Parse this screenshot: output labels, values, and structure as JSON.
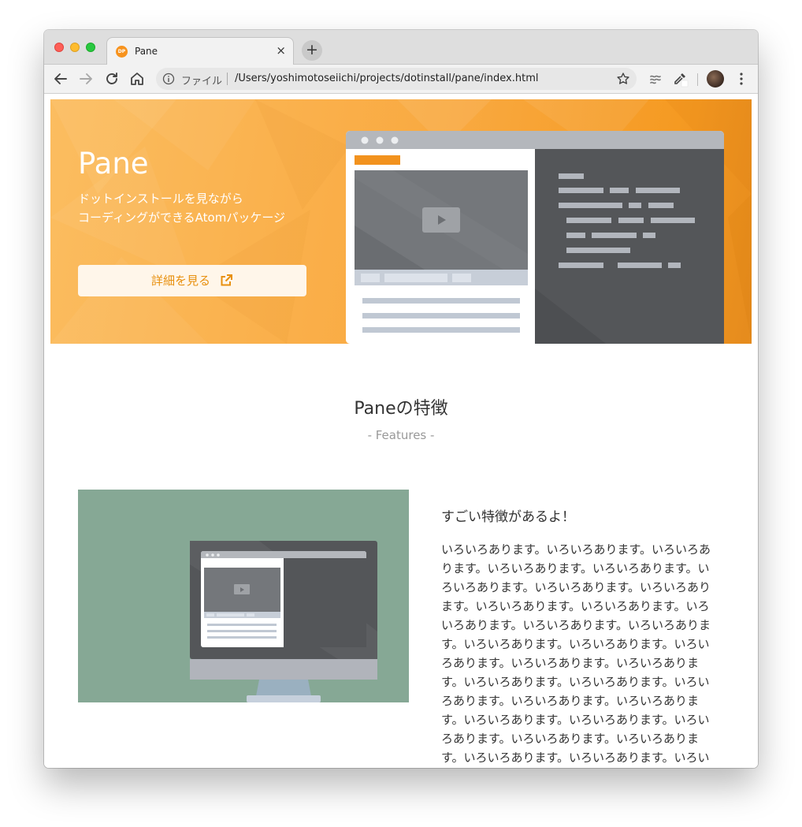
{
  "browser": {
    "tab": {
      "title": "Pane",
      "favicon_text": "DP",
      "close_glyph": "×"
    },
    "new_tab_glyph": "+",
    "address_bar": {
      "scheme_label": "ファイル",
      "url": "/Users/yoshimotoseiichi/projects/dotinstall/pane/index.html"
    },
    "icons": [
      "back-icon",
      "forward-icon",
      "reload-icon",
      "home-icon",
      "info-icon",
      "star-icon",
      "extension-icon",
      "eyedropper-icon",
      "avatar",
      "menu-icon"
    ]
  },
  "hero": {
    "title": "Pane",
    "subtitle_line1": "ドットインストールを見ながら",
    "subtitle_line2": "コーディングができるAtomパッケージ",
    "button_label": "詳細を見る"
  },
  "features": {
    "title": "Paneの特徴",
    "subtitle": "- Features -",
    "item": {
      "heading": "すごい特徴があるよ！",
      "body": "いろいろあります。いろいろあります。いろいろあります。いろいろあります。いろいろあります。いろいろあります。いろいろあります。いろいろあります。いろいろあります。いろいろあります。いろいろあります。いろいろあります。いろいろあります。いろいろあります。いろいろあります。いろいろあります。いろいろあります。いろいろあります。いろいろあります。いろいろあります。いろいろあります。いろいろあります。いろいろあります。いろいろあります。いろいろあります。いろいろあります。いろいろあります。いろいろあります。いろいろあります。いろいろあります。いろいろあります。い"
    }
  },
  "colors": {
    "hero_orange": "#f9a940",
    "accent": "#e8900f",
    "feature_bg": "#86a895",
    "dark_panel": "#545659"
  }
}
